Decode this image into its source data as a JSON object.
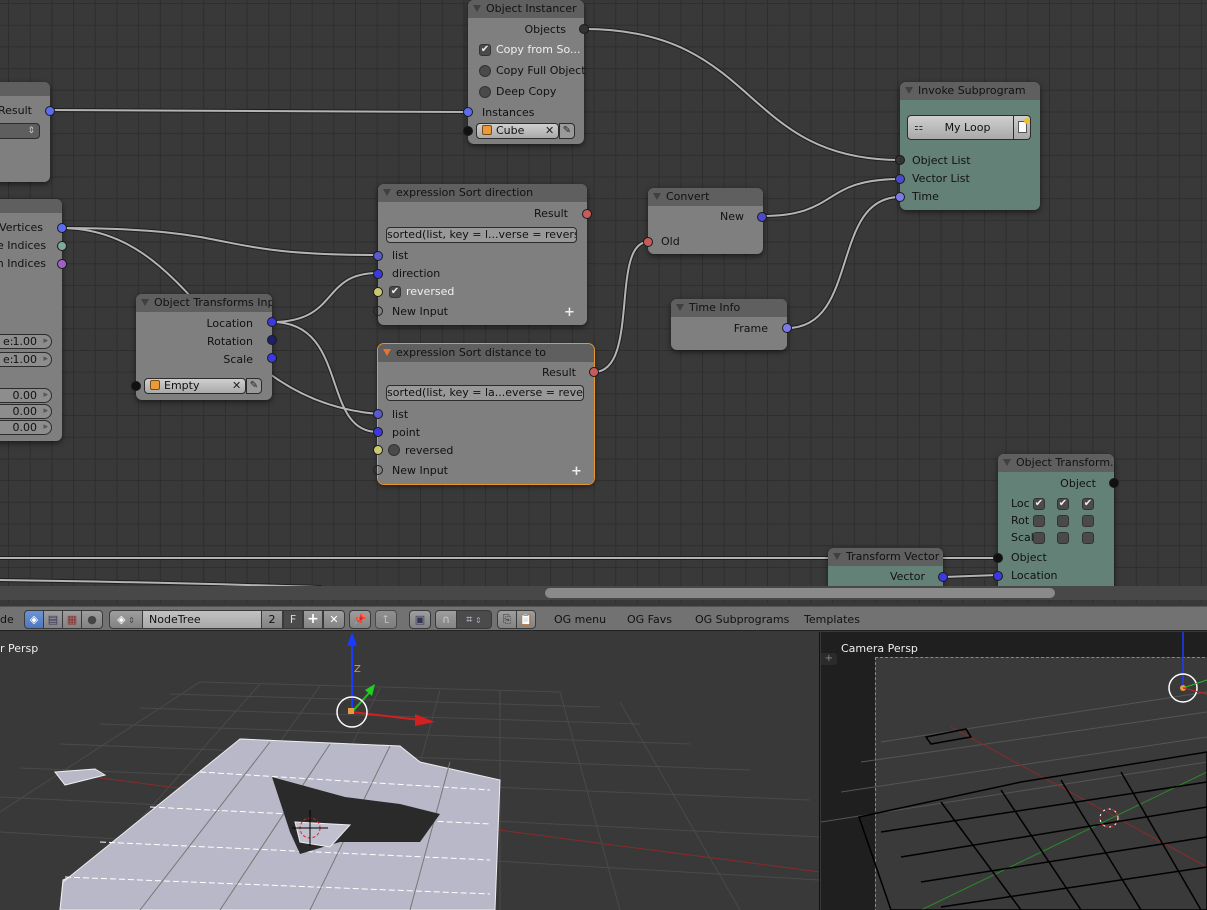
{
  "node_editor": {
    "nodes": {
      "left_partial_top": {
        "output_label": "Result"
      },
      "left_partial_mesh": {
        "outputs": [
          "Vertices",
          "ge Indices",
          "on Indices"
        ],
        "values": [
          {
            "label": "e:",
            "value": "1.00"
          },
          {
            "label": "e:",
            "value": "1.00"
          },
          {
            "label": "",
            "value": "0.00"
          },
          {
            "label": "",
            "value": "0.00"
          },
          {
            "label": "",
            "value": "0.00"
          }
        ]
      },
      "object_instancer": {
        "title": "Object Instancer",
        "output": "Objects",
        "options": [
          {
            "label": "Copy from So...",
            "checked": true
          },
          {
            "label": "Copy Full Object",
            "checked": false
          },
          {
            "label": "Deep Copy",
            "checked": false
          }
        ],
        "input": "Instances",
        "object_field": "Cube"
      },
      "invoke_subprogram": {
        "title": "Invoke Subprogram",
        "subprogram": "My Loop",
        "inputs": [
          "Object List",
          "Vector List",
          "Time"
        ]
      },
      "sort_direction": {
        "title": "expression Sort direction",
        "output": "Result",
        "expression": "sorted(list, key = l...verse = reversed)",
        "inputs": [
          "list",
          "direction"
        ],
        "reversed_label": "reversed",
        "reversed_checked": true,
        "new_input": "New Input"
      },
      "sort_distance": {
        "title": "expression Sort distance to",
        "output": "Result",
        "expression": "sorted(list, key = la...everse = reversed)",
        "inputs": [
          "list",
          "point"
        ],
        "reversed_label": "reversed",
        "reversed_checked": false,
        "new_input": "New Input"
      },
      "convert": {
        "title": "Convert",
        "output": "New",
        "input": "Old"
      },
      "time_info": {
        "title": "Time Info",
        "output": "Frame"
      },
      "object_transforms_input": {
        "title": "Object Transforms Inpu",
        "outputs": [
          "Location",
          "Rotation",
          "Scale"
        ],
        "object_field": "Empty"
      },
      "object_transform_output": {
        "title": "Object Transform...",
        "output": "Object",
        "rows": [
          {
            "label": "Loc",
            "checks": [
              true,
              true,
              true
            ]
          },
          {
            "label": "Rot",
            "checks": [
              false,
              false,
              false
            ]
          },
          {
            "label": "Scal",
            "checks": [
              false,
              false,
              false
            ]
          }
        ],
        "inputs": [
          "Object",
          "Location"
        ]
      },
      "transform_vector": {
        "title": "Transform Vector",
        "output": "Vector"
      }
    }
  },
  "header": {
    "mode_partial": "de",
    "node_tree_name": "NodeTree",
    "users_count": "2",
    "fake_user": "F",
    "menus": [
      "OG menu",
      "OG Favs",
      "OG Subprograms",
      "Templates"
    ],
    "icons": [
      "shader-nodes-icon",
      "texture-nodes-icon",
      "checker-icon",
      "sphere-icon",
      "node-tree-icon",
      "add-icon",
      "close-icon",
      "pin-icon",
      "parent-icon",
      "render-icon",
      "snap-icon",
      "snap-grid-icon",
      "copy-icon",
      "paste-icon"
    ]
  },
  "viewports": {
    "left": {
      "label": "r Persp"
    },
    "right": {
      "label": "Camera Persp"
    }
  },
  "colors": {
    "node_bg": "#7f7f7f",
    "node_teal": "#648178",
    "active_outline": "#e8952c",
    "grid_bg": "#393939"
  }
}
